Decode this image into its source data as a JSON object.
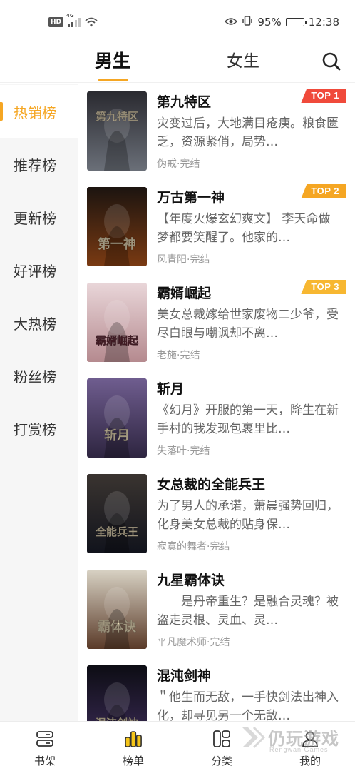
{
  "status_bar": {
    "hd": "HD",
    "network": "4G",
    "battery": "95%",
    "battery_level": 0.95,
    "time": "12:38"
  },
  "top_tabs": [
    {
      "label": "男生",
      "selected": true
    },
    {
      "label": "女生",
      "selected": false
    }
  ],
  "search_icon": "search-icon",
  "sidebar": {
    "items": [
      {
        "label": "热销榜",
        "active": true
      },
      {
        "label": "推荐榜",
        "active": false
      },
      {
        "label": "更新榜",
        "active": false
      },
      {
        "label": "好评榜",
        "active": false
      },
      {
        "label": "大热榜",
        "active": false
      },
      {
        "label": "粉丝榜",
        "active": false
      },
      {
        "label": "打赏榜",
        "active": false
      }
    ]
  },
  "books": [
    {
      "title": "第九特区",
      "desc": "灾变过后，大地满目疮痍。粮食匮乏，资源紧俏，局势…",
      "author_status": "伪戒·完结",
      "badge": "TOP 1",
      "badge_color": "#f04a3b",
      "cover_text": "第九特区",
      "cover_colors": [
        "#2a2a30",
        "#6a6f78"
      ]
    },
    {
      "title": "万古第一神",
      "desc": "【年度火爆玄幻爽文】 李天命做梦都要笑醒了。他家的…",
      "author_status": "风青阳·完结",
      "badge": "TOP 2",
      "badge_color": "#f5a623",
      "cover_text": "第一神",
      "cover_colors": [
        "#1c1410",
        "#7a3a12"
      ]
    },
    {
      "title": "霸婿崛起",
      "desc": "美女总裁嫁给世家废物二少爷，受尽白眼与嘲讽却不离…",
      "author_status": "老施·完结",
      "badge": "TOP 3",
      "badge_color": "#f7b731",
      "cover_text": "霸婿崛起",
      "cover_colors": [
        "#e9d6d9",
        "#b58a8f"
      ]
    },
    {
      "title": "斩月",
      "desc": "《幻月》开服的第一天，降生在新手村的我发现包裹里比…",
      "author_status": "失落叶·完结",
      "badge": "",
      "badge_color": "",
      "cover_text": "斩月",
      "cover_colors": [
        "#6f5d8f",
        "#2e2540"
      ]
    },
    {
      "title": "女总裁的全能兵王",
      "desc": "为了男人的承诺，萧晨强势回归，化身美女总裁的贴身保…",
      "author_status": "寂寞的舞者·完结",
      "badge": "",
      "badge_color": "",
      "cover_text": "全能兵王",
      "cover_colors": [
        "#3a3430",
        "#11131c"
      ]
    },
    {
      "title": "九星霸体诀",
      "desc": "　　是丹帝重生？是融合灵魂？被盗走灵根、灵血、灵…",
      "author_status": "平凡魔术师·完结",
      "badge": "",
      "badge_color": "",
      "cover_text": "霸体诀",
      "cover_colors": [
        "#d8d2c4",
        "#5a3a28"
      ]
    },
    {
      "title": "混沌剑神",
      "desc": "＂他生而无敌，一手快剑法出神入化，却寻见另一个无敌…",
      "author_status": "",
      "badge": "",
      "badge_color": "",
      "cover_text": "混沌剑神",
      "cover_colors": [
        "#0d0d14",
        "#3a2a55"
      ]
    }
  ],
  "bottom_nav": [
    {
      "label": "书架",
      "icon": "bookshelf-icon",
      "active": false
    },
    {
      "label": "榜单",
      "icon": "ranking-icon",
      "active": true
    },
    {
      "label": "分类",
      "icon": "category-icon",
      "active": false
    },
    {
      "label": "我的",
      "icon": "profile-icon",
      "active": false
    }
  ],
  "watermark": {
    "text": "仍玩游戏",
    "sub": "Rengwan Games"
  },
  "colors": {
    "accent": "#f5a623",
    "sidebar_bg": "#f6f6f6"
  }
}
